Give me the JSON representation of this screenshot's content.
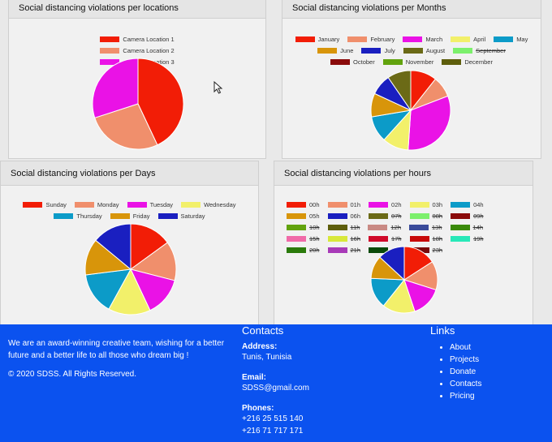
{
  "charts": {
    "locations": {
      "title": "Social distancing violations per locations",
      "chart_data": {
        "type": "pie",
        "categories": [
          "Camera Location 1",
          "Camera Location 2",
          "Camera Location 3"
        ],
        "values": [
          43,
          27,
          30
        ],
        "colors": [
          "#f21d06",
          "#f08f6c",
          "#ea12e6"
        ],
        "hidden": [
          false,
          false,
          false
        ],
        "title": "Social distancing violations per locations",
        "legend": "top"
      }
    },
    "months": {
      "title": "Social distancing violations per Months",
      "chart_data": {
        "type": "pie",
        "categories": [
          "January",
          "February",
          "March",
          "April",
          "May",
          "June",
          "July",
          "August",
          "September",
          "October",
          "November",
          "December"
        ],
        "values": [
          10,
          8,
          30,
          10,
          10,
          9,
          8,
          9,
          0,
          0,
          0,
          0
        ],
        "colors": [
          "#f21d06",
          "#f08f6c",
          "#ea12e6",
          "#f2f06a",
          "#0c9bc8",
          "#d8950a",
          "#1a1fc0",
          "#6b6a16",
          "#7cf06c",
          "#8a0a0a",
          "#62a30e",
          "#5e5e0c"
        ],
        "hidden": [
          false,
          false,
          false,
          false,
          false,
          false,
          false,
          false,
          true,
          false,
          false,
          false
        ],
        "title": "Social distancing violations per Months",
        "legend": "top"
      }
    },
    "days": {
      "title": "Social distancing violations per Days",
      "chart_data": {
        "type": "pie",
        "categories": [
          "Sunday",
          "Monday",
          "Tuesday",
          "Wednesday",
          "Thursday",
          "Friday",
          "Saturday"
        ],
        "values": [
          15,
          14,
          14,
          15,
          15,
          13,
          14
        ],
        "colors": [
          "#f21d06",
          "#f08f6c",
          "#ea12e6",
          "#f2f06a",
          "#0c9bc8",
          "#d8950a",
          "#1a1fc0"
        ],
        "hidden": [
          false,
          false,
          false,
          false,
          false,
          false,
          false
        ],
        "title": "Social distancing violations per Days",
        "legend": "top"
      }
    },
    "hours": {
      "title": "Social distancing violations per hours",
      "chart_data": {
        "type": "pie",
        "categories": [
          "00h",
          "01h",
          "02h",
          "03h",
          "04h",
          "05h",
          "06h",
          "07h",
          "08h",
          "09h",
          "10h",
          "11h",
          "12h",
          "13h",
          "14h",
          "15h",
          "16h",
          "17h",
          "18h",
          "19h",
          "20h",
          "21h",
          "22h",
          "23h"
        ],
        "values": [
          17,
          15,
          16,
          17,
          16,
          12,
          14,
          0,
          0,
          0,
          0,
          0,
          0,
          0,
          0,
          0,
          0,
          0,
          0,
          0,
          0,
          0,
          0,
          0
        ],
        "colors": [
          "#f21d06",
          "#f08f6c",
          "#ea12e6",
          "#f2f06a",
          "#0c9bc8",
          "#d8950a",
          "#1a1fc0",
          "#6b6a16",
          "#7cf06c",
          "#8a0a0a",
          "#62a30e",
          "#5e5e0c",
          "#c98a84",
          "#3a4b9a",
          "#3a8a0a",
          "#f06aa8",
          "#d8e83a",
          "#d00a2a",
          "#c80a0a",
          "#28e8b8",
          "#2a7a0a",
          "#a83ab8",
          "#0a4a0a",
          "#7a0a0a"
        ],
        "hidden": [
          false,
          false,
          false,
          false,
          false,
          false,
          false,
          true,
          true,
          true,
          true,
          true,
          true,
          true,
          true,
          true,
          true,
          true,
          true,
          true,
          true,
          true,
          true,
          true
        ],
        "title": "Social distancing violations per hours",
        "legend": "top"
      }
    }
  },
  "footer": {
    "about": "We are an award-winning creative team, wishing for a better future and a better life to all those who dream big !",
    "copyright": "© 2020 SDSS. All Rights Reserved.",
    "contacts_title": "Contacts",
    "address_label": "Address:",
    "address": "Tunis, Tunisia",
    "email_label": "Email:",
    "email": "SDSS@gmail.com",
    "phones_label": "Phones:",
    "phone1": "+216 25 515 140",
    "phone2": "+216 71 717 171",
    "links_title": "Links",
    "links": [
      "About",
      "Projects",
      "Donate",
      "Contacts",
      "Pricing"
    ]
  }
}
